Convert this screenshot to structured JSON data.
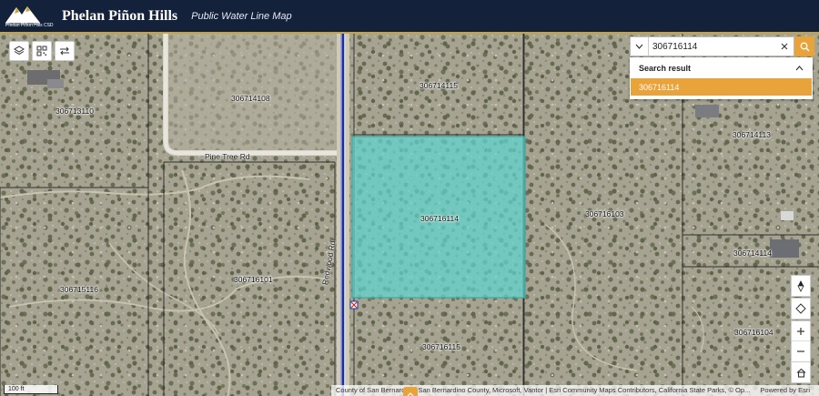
{
  "header": {
    "logo_text": "Phelan Piñon Hills CSD",
    "title": "Phelan Piñon Hills",
    "subtitle": "Public Water Line Map"
  },
  "toolbar": {
    "layers_icon": "layers-icon",
    "qr_icon": "qr-code-icon",
    "swap_icon": "swap-icon"
  },
  "search": {
    "value": "306716114",
    "results_header": "Search result",
    "results": [
      "306716114"
    ]
  },
  "map": {
    "parcels": [
      {
        "id": "306713110"
      },
      {
        "id": "306714108"
      },
      {
        "id": "306714115"
      },
      {
        "id": "306714113"
      },
      {
        "id": "306716114"
      },
      {
        "id": "306716103"
      },
      {
        "id": "306714114"
      },
      {
        "id": "306715116"
      },
      {
        "id": "306716101"
      },
      {
        "id": "306716104"
      },
      {
        "id": "306716115"
      }
    ],
    "roads": [
      {
        "name": "Pine Tree Rd"
      },
      {
        "name": "Redwood Rd"
      }
    ],
    "scale": "100 ft",
    "attribution": "County of San Bernardino, San Bernardino County, Microsoft, Vantor | Esri Community Maps Contributors, California State Parks, © Op...",
    "powered_by": "Powered by Esri"
  },
  "colors": {
    "header_bg": "#14213b",
    "accent": "#e8a33a",
    "highlight": "#5ed6d0",
    "water_line": "#1a2e9c"
  }
}
